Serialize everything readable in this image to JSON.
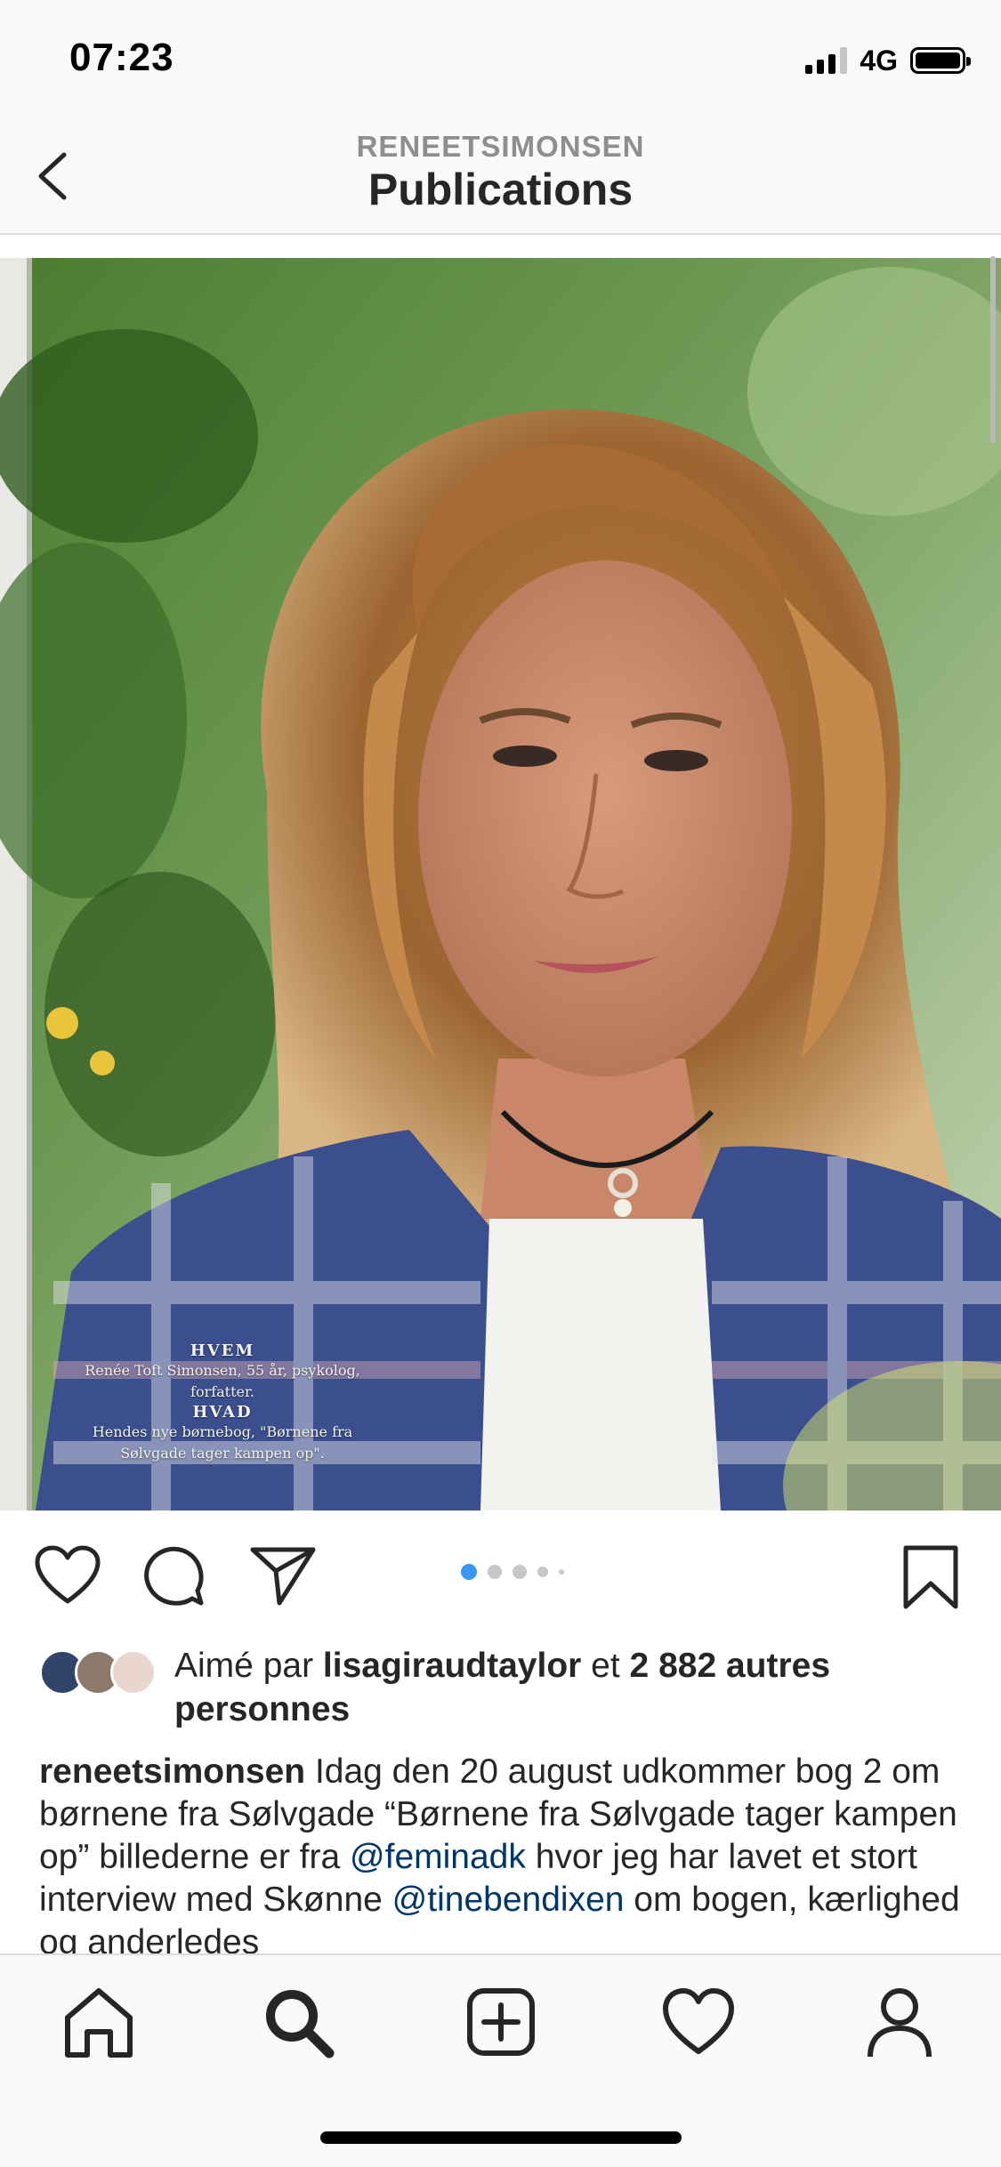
{
  "status_bar": {
    "time": "07:23",
    "network": "4G",
    "signal_icon": "cellular-signal-icon",
    "battery_icon": "battery-icon"
  },
  "header": {
    "username": "RENEETSIMONSEN",
    "title": "Publications",
    "back_icon": "chevron-left-icon"
  },
  "post": {
    "image_description_icon": "portrait-photo",
    "magazine_text": {
      "hvem_label": "HVEM",
      "hvem_text": "Renée Toft Simonsen, 55 år, psykolog, forfatter.",
      "hvad_label": "HVAD",
      "hvad_text": "Hendes nye børnebog, \"Børnene fra Sølvgade tager kampen op\"."
    },
    "carousel": {
      "total": 5,
      "active": 1
    },
    "actions": [
      "heart-icon",
      "comment-icon",
      "share-icon",
      "bookmark-icon"
    ]
  },
  "likes": {
    "prefix": "Aimé par ",
    "user": "lisagiraudtaylor",
    "middle": " et ",
    "count": "2 882 autres personnes"
  },
  "caption": {
    "author": "reneetsimonsen",
    "text1": " Idag den 20 august udkommer bog 2 om børnene fra Sølvgade “Børnene fra Sølvgade tager kampen op” billederne er fra ",
    "mention1": "@feminadk",
    "text2": " hvor jeg har lavet et stort interview med Skønne ",
    "mention2": "@tinebendixen",
    "text3": " om bogen, kærlighed og anderledes"
  },
  "tab_bar": {
    "tabs": [
      "home-icon",
      "search-icon",
      "new-post-icon",
      "activity-heart-icon",
      "profile-icon"
    ],
    "active": "search-icon"
  },
  "colors": {
    "mention": "#003569",
    "active_dot": "#3897f0",
    "text": "#262626",
    "muted": "#8e8e8e"
  }
}
